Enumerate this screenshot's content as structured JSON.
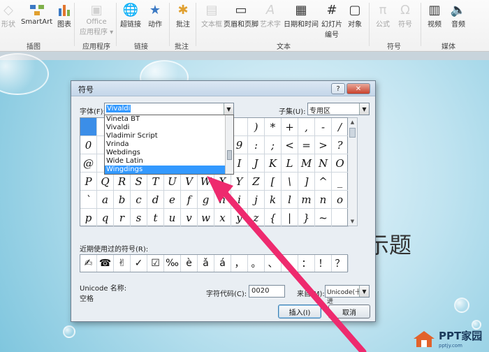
{
  "ribbon": {
    "buttons": [
      {
        "label": "形状",
        "icon": "shapes-icon",
        "disabled": true
      },
      {
        "label": "SmartArt",
        "icon": "smartart-icon",
        "disabled": false
      },
      {
        "label": "图表",
        "icon": "chart-icon",
        "disabled": false
      },
      {
        "label": "Office",
        "label2": "应用程序 ▾",
        "icon": "office-apps-icon",
        "disabled": true
      },
      {
        "label": "超链接",
        "icon": "hyperlink-icon",
        "disabled": false
      },
      {
        "label": "动作",
        "icon": "action-icon",
        "disabled": false
      },
      {
        "label": "批注",
        "icon": "comment-icon",
        "disabled": false
      },
      {
        "label": "文本框",
        "icon": "textbox-icon",
        "disabled": true
      },
      {
        "label": "页眉和页脚",
        "icon": "header-footer-icon",
        "disabled": false
      },
      {
        "label": "艺术字",
        "icon": "wordart-icon",
        "disabled": true
      },
      {
        "label": "日期和时间",
        "icon": "date-time-icon",
        "disabled": false
      },
      {
        "label": "幻灯片",
        "label2": "编号",
        "icon": "slide-number-icon",
        "disabled": false
      },
      {
        "label": "对象",
        "icon": "object-icon",
        "disabled": false
      },
      {
        "label": "公式",
        "icon": "equation-icon",
        "disabled": true
      },
      {
        "label": "符号",
        "icon": "symbol-icon",
        "disabled": true
      },
      {
        "label": "视频",
        "icon": "video-icon",
        "disabled": false
      },
      {
        "label": "音频",
        "icon": "audio-icon",
        "disabled": false
      }
    ],
    "groups": [
      "插图",
      "应用程序",
      "链接",
      "批注",
      "文本",
      "符号",
      "媒体"
    ]
  },
  "slide": {
    "title_fragment": "示题"
  },
  "watermark": {
    "text": "PPT家园",
    "subtext": "pptjy.com"
  },
  "dialog": {
    "title": "符号",
    "help_label": "?",
    "close_label": "✕",
    "font_label": "字体(F):",
    "font_value": "Vivaldi",
    "subset_label": "子集(U):",
    "subset_value": "专用区",
    "font_list": [
      "Vineta BT",
      "Vivaldi",
      "Vladimir Script",
      "Vrinda",
      "Webdings",
      "Wide Latin",
      "Wingdings"
    ],
    "font_list_selected": 6,
    "symbol_rows": [
      [
        "",
        "",
        "",
        "",
        "",
        "",
        "",
        "",
        "",
        "",
        ")",
        "*",
        "+",
        ",",
        "-",
        "/"
      ],
      [
        "0",
        "",
        "",
        "",
        "",
        "",
        "",
        "",
        "",
        "9",
        ":",
        ";",
        "<",
        "=",
        ">",
        "?"
      ],
      [
        "@",
        "",
        "",
        "",
        "",
        "",
        "",
        "",
        "",
        "I",
        "J",
        "K",
        "L",
        "M",
        "N",
        "O"
      ],
      [
        "P",
        "Q",
        "R",
        "S",
        "T",
        "U",
        "V",
        "W",
        "X",
        "Y",
        "Z",
        "[",
        "\\",
        "]",
        "^",
        "_"
      ],
      [
        "`",
        "a",
        "b",
        "c",
        "d",
        "e",
        "f",
        "g",
        "h",
        "i",
        "j",
        "k",
        "l",
        "m",
        "n",
        "o"
      ],
      [
        "p",
        "q",
        "r",
        "s",
        "t",
        "u",
        "v",
        "w",
        "x",
        "y",
        "z",
        "{",
        "|",
        "}",
        "~",
        ""
      ]
    ],
    "recent_label": "近期使用过的符号(R):",
    "recent_symbols": [
      "✍",
      "☎",
      "✌",
      "✓",
      "☑",
      "‰",
      "è",
      "ǎ",
      "á",
      "，",
      "。",
      "、",
      "；",
      "：",
      "！",
      "？"
    ],
    "unicode_name_label": "Unicode 名称:",
    "unicode_name_value": "空格",
    "char_code_label": "字符代码(C):",
    "char_code_value": "0020",
    "from_label": "来自(M):",
    "from_value": "Unicode(十六进",
    "insert_label": "插入(I)",
    "cancel_label": "取消"
  }
}
